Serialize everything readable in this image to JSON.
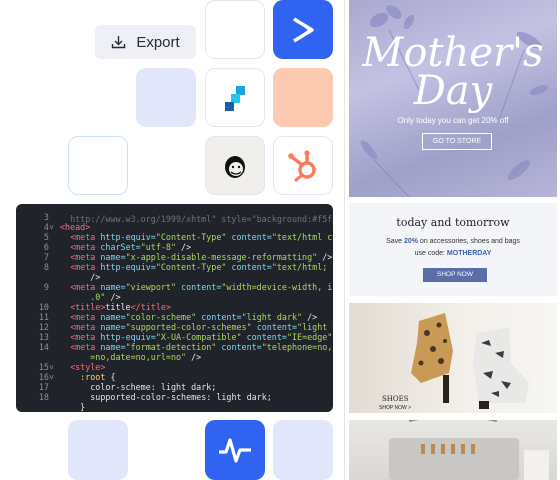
{
  "export_button": {
    "label": "Export",
    "icon": "download-icon"
  },
  "integrations": {
    "icons": [
      "sendinblue-icon",
      "stripo-icon",
      "mailchimp-icon",
      "hubspot-icon",
      "analytics-pulse-icon"
    ],
    "colors": {
      "blue": "#2f63f0",
      "lavender": "#e2e6fb",
      "peach": "#fccab0",
      "hubspot": "#ff7a59",
      "stripo": "#1fa3e0"
    }
  },
  "code": {
    "lines": [
      {
        "n": "3",
        "fold": false,
        "html": ""
      },
      {
        "n": "4",
        "fold": true,
        "html": "<span class='t'>&lt;head&gt;</span>"
      },
      {
        "n": "5",
        "fold": false,
        "html": "  <span class='t'>&lt;meta</span> <span class='a'>http-equiv=</span><span class='s'>\"Content-Type\"</span> <span class='a'>content=</span><span class='s'>\"text/html charset</span>"
      },
      {
        "n": "6",
        "fold": false,
        "html": "  <span class='t'>&lt;meta</span> <span class='a'>charSet=</span><span class='s'>\"utf-8\"</span> <span class='w'>/&gt;</span>"
      },
      {
        "n": "7",
        "fold": false,
        "html": "  <span class='t'>&lt;meta</span> <span class='a'>name=</span><span class='s'>\"x-apple-disable-message-reformatting\"</span> <span class='w'>/&gt;</span>"
      },
      {
        "n": "8",
        "fold": false,
        "html": "  <span class='t'>&lt;meta</span> <span class='a'>http-equiv=</span><span class='s'>\"Content-Type\"</span> <span class='a'>content=</span><span class='s'>\"text/html; charse</span>"
      },
      {
        "n": "",
        "fold": false,
        "html": "      <span class='w'>/&gt;</span>"
      },
      {
        "n": "9",
        "fold": false,
        "html": "  <span class='t'>&lt;meta</span> <span class='a'>name=</span><span class='s'>\"viewport\"</span> <span class='a'>content=</span><span class='s'>\"width=device-width, initia</span>"
      },
      {
        "n": "",
        "fold": false,
        "html": "      <span class='s'>.0\"</span> <span class='w'>/&gt;</span>"
      },
      {
        "n": "10",
        "fold": false,
        "html": "  <span class='t'>&lt;title&gt;</span><span class='w'>title</span><span class='t'>&lt;/title&gt;</span>"
      },
      {
        "n": "11",
        "fold": false,
        "html": "  <span class='t'>&lt;meta</span> <span class='a'>name=</span><span class='s'>\"color-scheme\"</span> <span class='a'>content=</span><span class='s'>\"light dark\"</span> <span class='w'>/&gt;</span>"
      },
      {
        "n": "12",
        "fold": false,
        "html": "  <span class='t'>&lt;meta</span> <span class='a'>name=</span><span class='s'>\"supported-color-schemes\"</span> <span class='a'>content=</span><span class='s'>\"light dark\"</span>"
      },
      {
        "n": "13",
        "fold": false,
        "html": "  <span class='t'>&lt;meta</span> <span class='a'>http-equiv=</span><span class='s'>\"X-UA-Compatible\"</span> <span class='a'>content=</span><span class='s'>\"IE=edge\"</span> <span class='w'>/&gt;</span>"
      },
      {
        "n": "14",
        "fold": false,
        "html": "  <span class='t'>&lt;meta</span> <span class='a'>name=</span><span class='s'>\"format-detection\"</span> <span class='a'>content=</span><span class='s'>\"telephone=no,addre</span>"
      },
      {
        "n": "",
        "fold": false,
        "html": "      <span class='s'>=no,date=no,url=no\"</span> <span class='w'>/&gt;</span>"
      },
      {
        "n": "15",
        "fold": true,
        "html": "  <span class='t'>&lt;style&gt;</span>"
      },
      {
        "n": "16",
        "fold": true,
        "html": "    <span class='p'>:root</span> <span class='w'>{</span>"
      },
      {
        "n": "17",
        "fold": false,
        "html": "      <span class='w'>color-scheme: light dark;</span>"
      },
      {
        "n": "18",
        "fold": false,
        "html": "      <span class='w'>supported-color-schemes: light dark;</span>"
      },
      {
        "n": "",
        "fold": false,
        "html": "    <span class='w'>}</span>"
      }
    ]
  },
  "email_preview": {
    "hero": {
      "title_line1": "Mother's",
      "title_line2": "Day",
      "subtitle": "Only today you can get 20% off",
      "cta": "GO TO STORE"
    },
    "promo": {
      "title": "today and tomorrow",
      "line1_pre": "Save ",
      "line1_highlight": "20%",
      "line1_post": " on accessories, shoes and bags",
      "line2_pre": "use code: ",
      "line2_code": "MOTHERDAY",
      "cta": "SHOP NOW"
    },
    "shoes": {
      "title": "SHOES",
      "cta": "SHOP NOW >"
    }
  }
}
